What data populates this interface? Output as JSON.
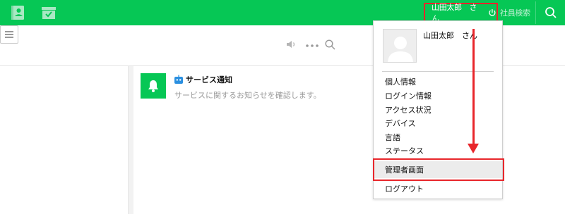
{
  "header": {
    "user_name": "山田太郎　さん",
    "search_placeholder": "社員検索"
  },
  "notification": {
    "title": "サービス通知",
    "text": "サービスに関するお知らせを確認します。"
  },
  "dropdown": {
    "user_name": "山田太郎　さん",
    "items": [
      "個人情報",
      "ログイン情報",
      "アクセス状況",
      "デバイス",
      "言語",
      "ステータス"
    ],
    "admin_label": "管理者画面",
    "logout_label": "ログアウト"
  },
  "colors": {
    "brand_green": "#06c755",
    "annotation_red": "#e8262b"
  },
  "icons": [
    "contacts-icon",
    "archive-icon",
    "power-icon",
    "search-icon",
    "speaker-icon",
    "more-icon",
    "menu-icon",
    "bell-icon",
    "bot-icon",
    "avatar-placeholder-icon"
  ]
}
